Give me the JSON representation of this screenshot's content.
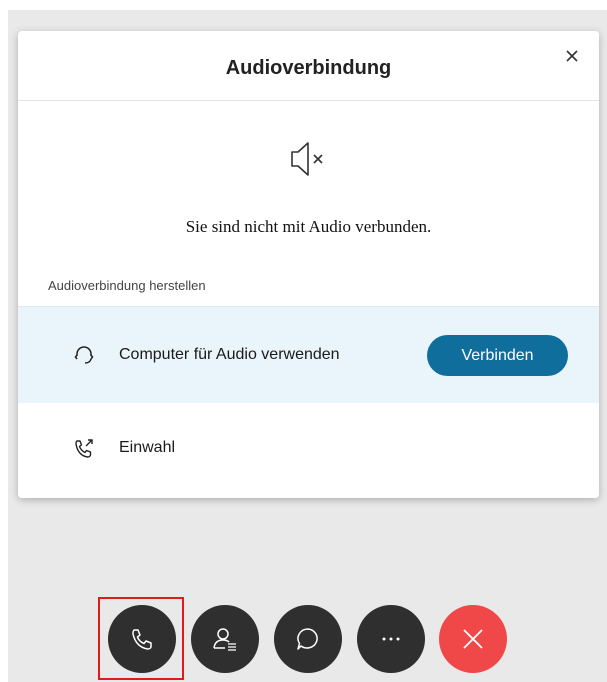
{
  "dialog": {
    "title": "Audioverbindung",
    "close_label": "×",
    "status_text": "Sie sind nicht mit Audio verbunden.",
    "section_label": "Audioverbindung herstellen",
    "options": [
      {
        "label": "Computer für Audio verwenden",
        "icon": "headset-icon",
        "button_label": "Verbinden",
        "highlighted": true
      },
      {
        "label": "Einwahl",
        "icon": "phone-dial-icon"
      }
    ]
  },
  "controls": [
    {
      "icon": "phone-icon",
      "selected": true
    },
    {
      "icon": "participants-icon"
    },
    {
      "icon": "chat-icon"
    },
    {
      "icon": "more-icon"
    },
    {
      "icon": "leave-icon"
    }
  ],
  "colors": {
    "accent": "#0f6e9c",
    "option_highlight_bg": "#eaf4fb",
    "control_dark": "#2f2f2f",
    "leave_red": "#f04848",
    "selection_outline": "#e01b1b",
    "stage_bg": "#e9e9e9"
  }
}
